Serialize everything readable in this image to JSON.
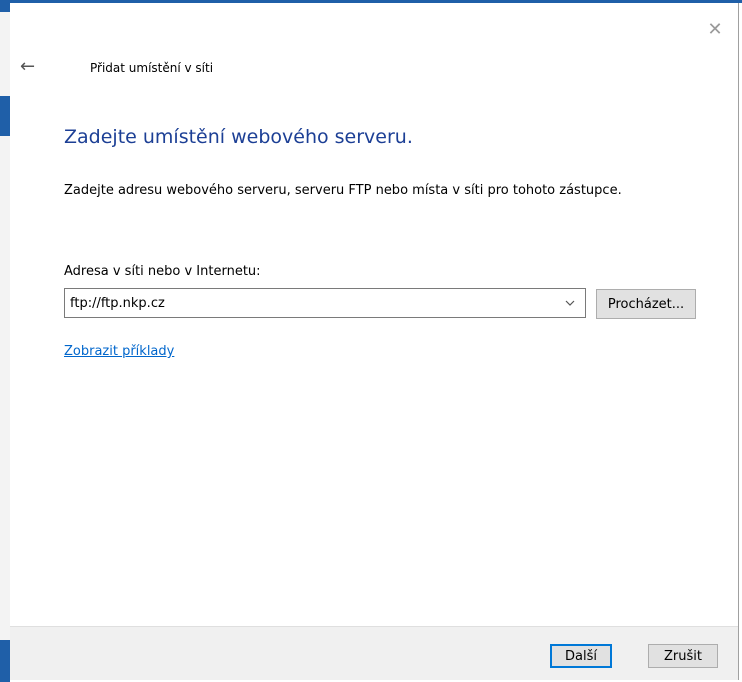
{
  "dialog": {
    "title": "Přidat umístění v síti",
    "close_symbol": "✕",
    "back_symbol": "←"
  },
  "main": {
    "heading": "Zadejte umístění webového serveru.",
    "description": "Zadejte adresu webového serveru, serveru FTP nebo místa v síti pro tohoto zástupce.",
    "address_label": "Adresa v síti nebo v Internetu:",
    "address_value": "ftp://ftp.nkp.cz",
    "browse_label": "Procházet...",
    "examples_link": "Zobrazit příklady"
  },
  "footer": {
    "next_label": "Další",
    "cancel_label": "Zrušit"
  },
  "icons": {
    "close": "close-icon",
    "back": "back-arrow-icon",
    "dropdown": "chevron-down-icon"
  },
  "colors": {
    "heading": "#1c3f95",
    "link": "#0066cc",
    "default_button_border": "#0078d7",
    "footer_bg": "#f0f0f0"
  }
}
